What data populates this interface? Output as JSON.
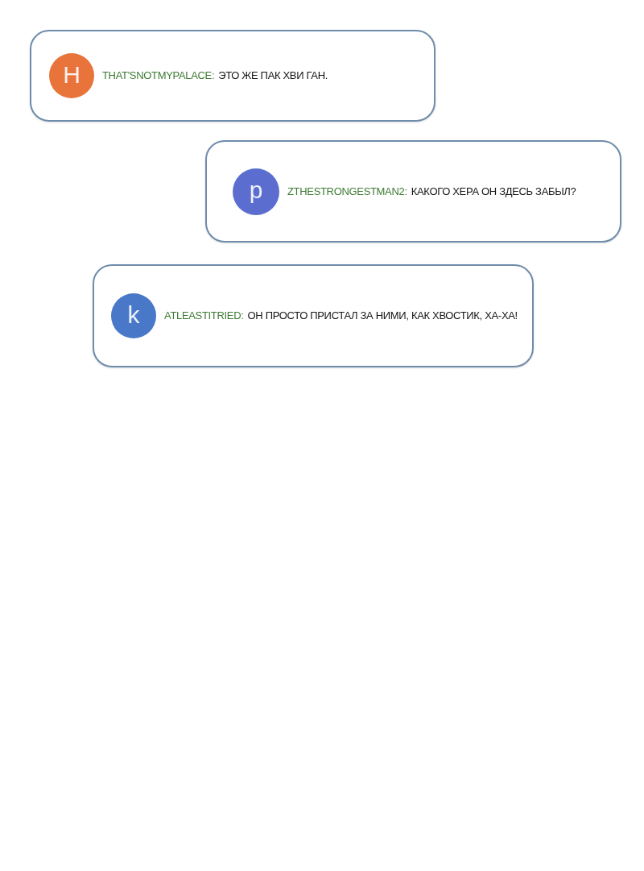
{
  "messages": [
    {
      "avatar_letter": "H",
      "color": "#e8743b",
      "username": "THAT'SNOTMYPALACE:",
      "text": "ЭТО ЖЕ ПАК ХВИ ГАН."
    },
    {
      "avatar_letter": "p",
      "color": "#5b6ed0",
      "username": "ZTHESTRONGESTMAN2:",
      "text": "КАКОГО ХЕРА ОН ЗДЕСЬ ЗАБЫЛ?"
    },
    {
      "avatar_letter": "k",
      "color": "#4a78c8",
      "username": "ATLEASTITRIED:",
      "text": "ОН ПРОСТО ПРИСТАЛ ЗА НИМИ, КАК ХВОСТИК, ХА-ХА!"
    }
  ]
}
